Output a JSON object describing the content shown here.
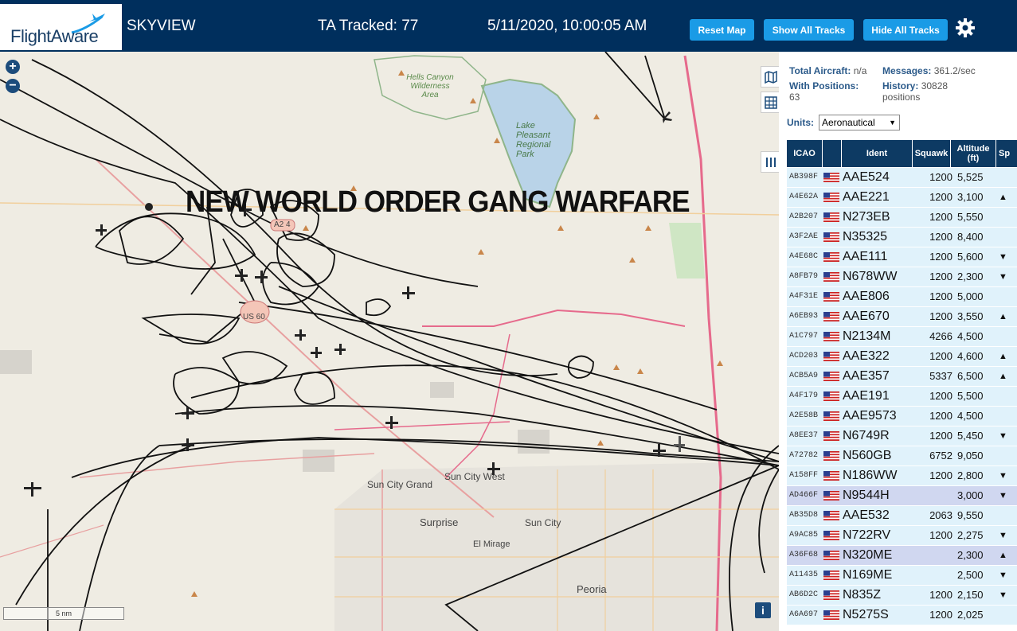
{
  "header": {
    "logo_text": "FlightAware",
    "app_name": "SKYVIEW",
    "tracked": "TA Tracked: 77",
    "datetime": "5/11/2020, 10:00:05 AM",
    "buttons": {
      "reset": "Reset Map",
      "show_all": "Show All Tracks",
      "hide_all": "Hide All Tracks"
    }
  },
  "map": {
    "overlay_text": "NEW WORLD ORDER GANG WARFARE",
    "scale_label": "5 nm",
    "labels": {
      "hells_canyon": "Hells Canyon Wilderness Area",
      "lake": "Lake Pleasant Regional Park",
      "sun_city_grand": "Sun City Grand",
      "sun_city_west": "Sun City West",
      "surprise": "Surprise",
      "sun_city": "Sun City",
      "el_mirage": "El Mirage",
      "peoria": "Peoria",
      "us60": "US 60",
      "a274": "A2 4"
    }
  },
  "stats": {
    "total_aircraft_label": "Total Aircraft:",
    "total_aircraft_value": "n/a",
    "messages_label": "Messages:",
    "messages_value": "361.2/sec",
    "with_positions_label": "With Positions:",
    "with_positions_value": "63",
    "history_label": "History:",
    "history_value": "30828 positions",
    "units_label": "Units:",
    "units_value": "Aeronautical"
  },
  "table": {
    "headers": {
      "icao": "ICAO",
      "ident": "Ident",
      "squawk": "Squawk",
      "altitude": "Altitude (ft)",
      "speed": "Sp"
    },
    "rows": [
      {
        "icao": "AB398F",
        "ident": "AAE524",
        "squawk": "1200",
        "alt": "5,525",
        "arrow": ""
      },
      {
        "icao": "A4E62A",
        "ident": "AAE221",
        "squawk": "1200",
        "alt": "3,100",
        "arrow": "▲"
      },
      {
        "icao": "A2B207",
        "ident": "N273EB",
        "squawk": "1200",
        "alt": "5,550",
        "arrow": ""
      },
      {
        "icao": "A3F2AE",
        "ident": "N35325",
        "squawk": "1200",
        "alt": "8,400",
        "arrow": ""
      },
      {
        "icao": "A4E68C",
        "ident": "AAE111",
        "squawk": "1200",
        "alt": "5,600",
        "arrow": "▼"
      },
      {
        "icao": "A8FB79",
        "ident": "N678WW",
        "squawk": "1200",
        "alt": "2,300",
        "arrow": "▼"
      },
      {
        "icao": "A4F31E",
        "ident": "AAE806",
        "squawk": "1200",
        "alt": "5,000",
        "arrow": ""
      },
      {
        "icao": "A6EB93",
        "ident": "AAE670",
        "squawk": "1200",
        "alt": "3,550",
        "arrow": "▲"
      },
      {
        "icao": "A1C797",
        "ident": "N2134M",
        "squawk": "4266",
        "alt": "4,500",
        "arrow": ""
      },
      {
        "icao": "ACD203",
        "ident": "AAE322",
        "squawk": "1200",
        "alt": "4,600",
        "arrow": "▲"
      },
      {
        "icao": "ACB5A9",
        "ident": "AAE357",
        "squawk": "5337",
        "alt": "6,500",
        "arrow": "▲"
      },
      {
        "icao": "A4F179",
        "ident": "AAE191",
        "squawk": "1200",
        "alt": "5,500",
        "arrow": ""
      },
      {
        "icao": "A2E58B",
        "ident": "AAE9573",
        "squawk": "1200",
        "alt": "4,500",
        "arrow": ""
      },
      {
        "icao": "A8EE37",
        "ident": "N6749R",
        "squawk": "1200",
        "alt": "5,450",
        "arrow": "▼"
      },
      {
        "icao": "A72782",
        "ident": "N560GB",
        "squawk": "6752",
        "alt": "9,050",
        "arrow": ""
      },
      {
        "icao": "A158FF",
        "ident": "N186WW",
        "squawk": "1200",
        "alt": "2,800",
        "arrow": "▼"
      },
      {
        "icao": "AD466F",
        "ident": "N9544H",
        "squawk": "",
        "alt": "3,000",
        "arrow": "▼",
        "sel": true
      },
      {
        "icao": "AB35D8",
        "ident": "AAE532",
        "squawk": "2063",
        "alt": "9,550",
        "arrow": ""
      },
      {
        "icao": "A9AC85",
        "ident": "N722RV",
        "squawk": "1200",
        "alt": "2,275",
        "arrow": "▼"
      },
      {
        "icao": "A36F68",
        "ident": "N320ME",
        "squawk": "",
        "alt": "2,300",
        "arrow": "▲",
        "sel": true
      },
      {
        "icao": "A11435",
        "ident": "N169ME",
        "squawk": "",
        "alt": "2,500",
        "arrow": "▼"
      },
      {
        "icao": "AB6D2C",
        "ident": "N835Z",
        "squawk": "1200",
        "alt": "2,150",
        "arrow": "▼"
      },
      {
        "icao": "A6A697",
        "ident": "N5275S",
        "squawk": "1200",
        "alt": "2,025",
        "arrow": ""
      }
    ]
  }
}
